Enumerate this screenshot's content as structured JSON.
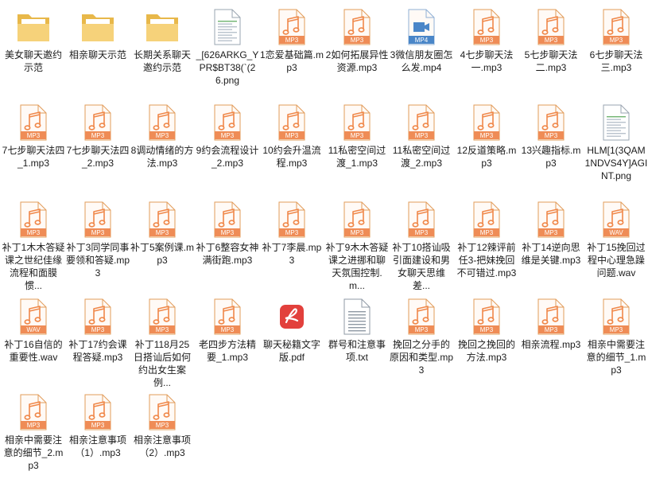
{
  "colors": {
    "doc_fill": "#fffaf6",
    "doc_stroke": "#e29c5a",
    "audio_accent": "#f0884a",
    "audio_badge": "#ef8c56",
    "video_badge": "#4a86c8",
    "folder_back": "#e8b84a",
    "folder_front": "#f6d27a",
    "pdf_red": "#e2403c"
  },
  "files": [
    {
      "label": "美女聊天邀约示范",
      "type": "folder",
      "icon": "folder-icon"
    },
    {
      "label": "相亲聊天示范",
      "type": "folder",
      "icon": "folder-icon"
    },
    {
      "label": "长期关系聊天邀约示范",
      "type": "folder",
      "icon": "folder-icon"
    },
    {
      "label": "_[626ARKG_YPR$BT38(`(26.png",
      "type": "png",
      "icon": "png-image-icon"
    },
    {
      "label": "1恋爱基础篇.mp3",
      "type": "mp3",
      "badge": "MP3",
      "icon": "music-file-icon"
    },
    {
      "label": "2如何拓展异性资源.mp3",
      "type": "mp3",
      "badge": "MP3",
      "icon": "music-file-icon"
    },
    {
      "label": "3微信朋友圈怎么发.mp4",
      "type": "mp4",
      "badge": "MP4",
      "icon": "video-file-icon"
    },
    {
      "label": "4七步聊天法一.mp3",
      "type": "mp3",
      "badge": "MP3",
      "icon": "music-file-icon"
    },
    {
      "label": "5七步聊天法二.mp3",
      "type": "mp3",
      "badge": "MP3",
      "icon": "music-file-icon"
    },
    {
      "label": "6七步聊天法三.mp3",
      "type": "mp3",
      "badge": "MP3",
      "icon": "music-file-icon"
    },
    {
      "label": "7七步聊天法四_1.mp3",
      "type": "mp3",
      "badge": "MP3",
      "icon": "music-file-icon"
    },
    {
      "label": "7七步聊天法四_2.mp3",
      "type": "mp3",
      "badge": "MP3",
      "icon": "music-file-icon"
    },
    {
      "label": "8调动情绪的方法.mp3",
      "type": "mp3",
      "badge": "MP3",
      "icon": "music-file-icon"
    },
    {
      "label": "9约会流程设计_2.mp3",
      "type": "mp3",
      "badge": "MP3",
      "icon": "music-file-icon"
    },
    {
      "label": "10约会升温流程.mp3",
      "type": "mp3",
      "badge": "MP3",
      "icon": "music-file-icon"
    },
    {
      "label": "11私密空间过渡_1.mp3",
      "type": "mp3",
      "badge": "MP3",
      "icon": "music-file-icon"
    },
    {
      "label": "11私密空间过渡_2.mp3",
      "type": "mp3",
      "badge": "MP3",
      "icon": "music-file-icon"
    },
    {
      "label": "12反道策略.mp3",
      "type": "mp3",
      "badge": "MP3",
      "icon": "music-file-icon"
    },
    {
      "label": "13兴趣指标.mp3",
      "type": "mp3",
      "badge": "MP3",
      "icon": "music-file-icon"
    },
    {
      "label": "HLM[1(3QAM1NDVS4Y]AGINT.png",
      "type": "png",
      "icon": "png-image-icon"
    },
    {
      "label": "补丁1木木答疑课之世纪佳缘流程和面膜惯...",
      "type": "mp3",
      "badge": "MP3",
      "icon": "music-file-icon"
    },
    {
      "label": "补丁3同学同事要领和答疑.mp3",
      "type": "mp3",
      "badge": "MP3",
      "icon": "music-file-icon"
    },
    {
      "label": "补丁5案例课.mp3",
      "type": "mp3",
      "badge": "MP3",
      "icon": "music-file-icon"
    },
    {
      "label": "补丁6整容女神满街跑.mp3",
      "type": "mp3",
      "badge": "MP3",
      "icon": "music-file-icon"
    },
    {
      "label": "补丁7李晨.mp3",
      "type": "mp3",
      "badge": "MP3",
      "icon": "music-file-icon"
    },
    {
      "label": "补丁9木木答疑课之进挪和聊天氛围控制.m...",
      "type": "mp3",
      "badge": "MP3",
      "icon": "music-file-icon"
    },
    {
      "label": "补丁10搭讪吸引面建设和男女聊天思维差...",
      "type": "mp3",
      "badge": "MP3",
      "icon": "music-file-icon"
    },
    {
      "label": "补丁12辣评前任3-把妹挽回不可错过.mp3",
      "type": "mp3",
      "badge": "MP3",
      "icon": "music-file-icon"
    },
    {
      "label": "补丁14逆向思维是关键.mp3",
      "type": "mp3",
      "badge": "MP3",
      "icon": "music-file-icon"
    },
    {
      "label": "补丁15挽回过程中心理急躁问题.wav",
      "type": "wav",
      "badge": "WAV",
      "icon": "music-file-icon"
    },
    {
      "label": "补丁16自信的重要性.wav",
      "type": "wav",
      "badge": "WAV",
      "icon": "music-file-icon"
    },
    {
      "label": "补丁17约会课程答疑.mp3",
      "type": "mp3",
      "badge": "MP3",
      "icon": "music-file-icon"
    },
    {
      "label": "补丁118月25日搭讪后如何约出女生案例...",
      "type": "mp3",
      "badge": "MP3",
      "icon": "music-file-icon"
    },
    {
      "label": "老四步方法精要_1.mp3",
      "type": "mp3",
      "badge": "MP3",
      "icon": "music-file-icon"
    },
    {
      "label": "聊天秘籍文字版.pdf",
      "type": "pdf",
      "icon": "pdf-file-icon"
    },
    {
      "label": "群号和注意事项.txt",
      "type": "txt",
      "icon": "text-file-icon"
    },
    {
      "label": "挽回之分手的原因和类型.mp3",
      "type": "mp3",
      "badge": "MP3",
      "icon": "music-file-icon"
    },
    {
      "label": "挽回之挽回的方法.mp3",
      "type": "mp3",
      "badge": "MP3",
      "icon": "music-file-icon"
    },
    {
      "label": "相亲流程.mp3",
      "type": "mp3",
      "badge": "MP3",
      "icon": "music-file-icon"
    },
    {
      "label": "相亲中需要注意的细节_1.mp3",
      "type": "mp3",
      "badge": "MP3",
      "icon": "music-file-icon"
    },
    {
      "label": "相亲中需要注意的细节_2.mp3",
      "type": "mp3",
      "badge": "MP3",
      "icon": "music-file-icon"
    },
    {
      "label": "相亲注意事项（1）.mp3",
      "type": "mp3",
      "badge": "MP3",
      "icon": "music-file-icon"
    },
    {
      "label": "相亲注意事项（2）.mp3",
      "type": "mp3",
      "badge": "MP3",
      "icon": "music-file-icon"
    }
  ]
}
